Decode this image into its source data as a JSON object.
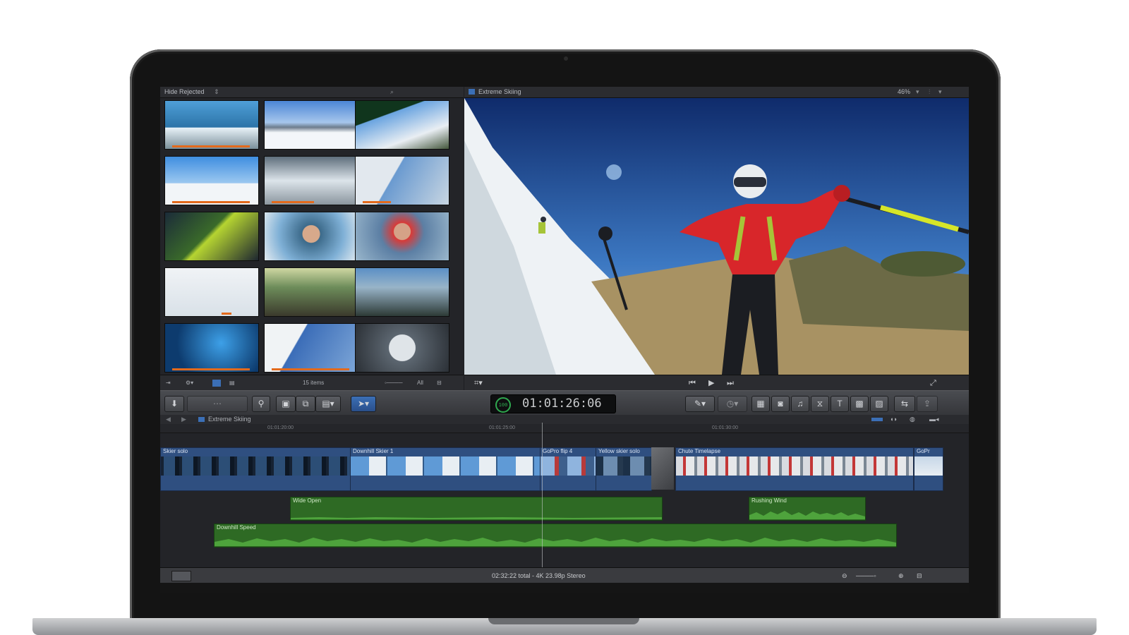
{
  "browser": {
    "filter_label": "Hide Rejected",
    "item_count": "15 items",
    "zoom_label": "All"
  },
  "viewer": {
    "project_title": "Extreme Skiing",
    "zoom": "46%"
  },
  "toolbar": {
    "timecode": "01:01:26:06",
    "timecode_badge": "100"
  },
  "timeline": {
    "project_title": "Extreme Skiing",
    "ruler_marks": [
      "01:01:20:00",
      "01:01:25:00",
      "01:01:30:00"
    ],
    "video_clips": [
      "Skier solo",
      "Downhill Skier 1",
      "GoPro flip 4",
      "Yellow skier solo",
      "Chute Timelapse",
      "GoPr"
    ],
    "audio_clips": [
      "Wide Open",
      "Rushing Wind",
      "Downhill Speed"
    ],
    "status": "02:32:22 total - 4K 23.98p Stereo"
  },
  "colors": {
    "video_clip": "#2f4f80",
    "audio_clip": "#2e6a24",
    "rating_bar": "#e36a1c",
    "ui_dark": "#1e1f22"
  }
}
